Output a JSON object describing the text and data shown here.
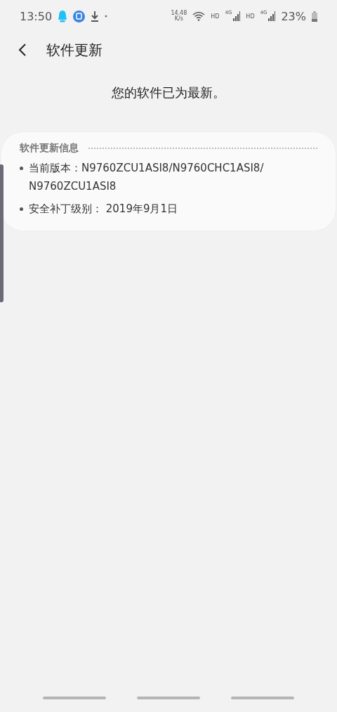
{
  "status_bar": {
    "time": "13:50",
    "net_speed": "14.48",
    "net_unit": "K/s",
    "sim1_hd": "HD",
    "sim1_net": "4G",
    "sim2_hd": "HD",
    "sim2_net": "4G",
    "battery": "23%"
  },
  "header": {
    "title": "软件更新"
  },
  "message": "您的软件已为最新。",
  "info_card": {
    "title": "软件更新信息",
    "items": [
      "当前版本：N9760ZCU1ASI8/N9760CHC1ASI8/N9760ZCU1ASI8",
      "安全补丁级别： 2019年9月1日"
    ]
  }
}
